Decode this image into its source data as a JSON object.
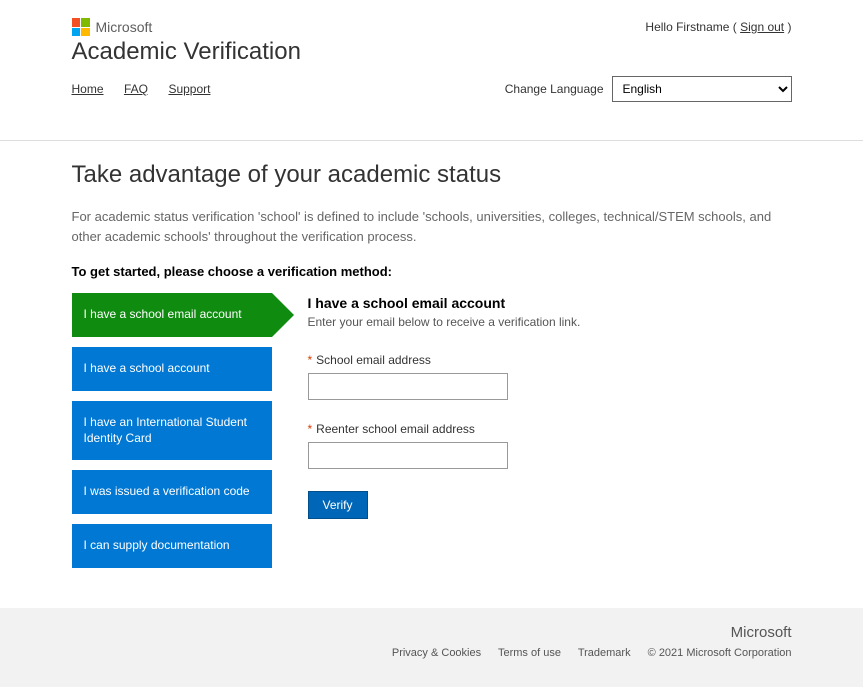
{
  "header": {
    "brand": "Microsoft",
    "title": "Academic Verification",
    "greeting_prefix": "Hello ",
    "greeting_name": "Firstname",
    "signout_prefix": " ( ",
    "signout_label": "Sign out",
    "signout_suffix": " )"
  },
  "nav": {
    "home": "Home",
    "faq": "FAQ",
    "support": "Support"
  },
  "language": {
    "label": "Change Language",
    "selected": "English"
  },
  "main": {
    "heading": "Take advantage of your academic status",
    "description": "For academic status verification 'school' is defined to include 'schools, universities, colleges, technical/STEM schools, and other academic schools' throughout the verification process.",
    "prompt": "To get started, please choose a verification method:"
  },
  "tabs": {
    "email": "I have a school email account",
    "account": "I have a school account",
    "isic": "I have an International Student Identity Card",
    "code": "I was issued a verification code",
    "docs": "I can supply documentation"
  },
  "form": {
    "title": "I have a school email account",
    "subtitle": "Enter your email below to receive a verification link.",
    "field1_label": "School email address",
    "field2_label": "Reenter school email address",
    "verify_button": "Verify"
  },
  "footer": {
    "brand": "Microsoft",
    "privacy": "Privacy & Cookies",
    "terms": "Terms of use",
    "trademark": "Trademark",
    "copyright": "© 2021 Microsoft Corporation"
  }
}
